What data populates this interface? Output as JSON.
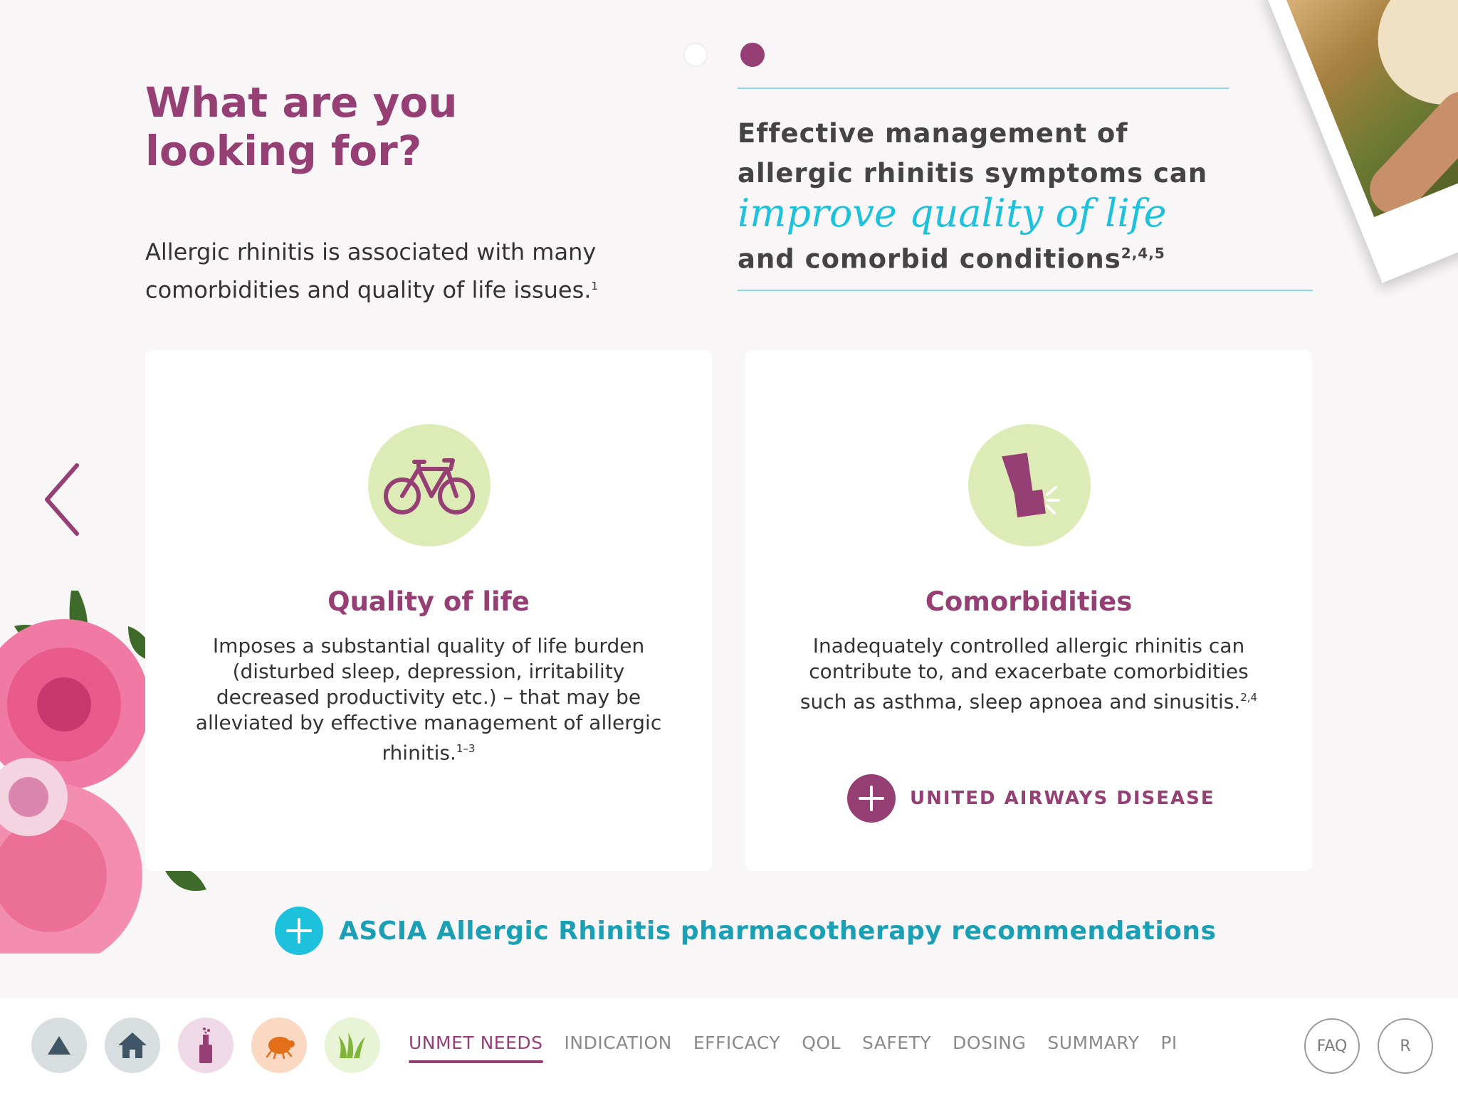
{
  "pagination": {
    "total": 2,
    "active_index": 1
  },
  "headline": "What are you looking for?",
  "intro": {
    "text": "Allergic rhinitis is associated with many comorbidities and quality of life issues.",
    "ref": "1"
  },
  "statement": {
    "line1": "Effective management of",
    "line2": "allergic rhinitis symptoms can",
    "highlight": "improve quality of life",
    "line3": "and comorbid conditions",
    "ref": "2,4,5"
  },
  "photo": {
    "description_icon": "dog-photo-icon"
  },
  "cards": [
    {
      "title": "Quality of life",
      "body": "Imposes a substantial quality of life burden (disturbed sleep, depression, irritability decreased productivity etc.) – that may be alleviated by effective management of allergic rhinitis.",
      "ref": "1–3",
      "icon": "bicycle-icon"
    },
    {
      "title": "Comorbidities",
      "body": "Inadequately controlled allergic rhinitis can contribute to, and exacerbate comorbidities such as asthma, sleep apnoea and sinusitis.",
      "ref": "2,4",
      "icon": "inhaler-icon",
      "link_label": "UNITED AIRWAYS DISEASE"
    }
  ],
  "ascia_link": "ASCIA Allergic Rhinitis pharmacotherapy recommendations",
  "bottom_nav": {
    "icons": [
      "top-triangle-icon",
      "home-icon",
      "spray-bottle-icon",
      "dust-mite-icon",
      "grass-icon"
    ],
    "links": [
      "UNMET NEEDS",
      "INDICATION",
      "EFFICACY",
      "QOL",
      "SAFETY",
      "DOSING",
      "SUMMARY",
      "PI"
    ],
    "active_link": "UNMET NEEDS",
    "faq_label": "FAQ",
    "r_label": "R"
  },
  "colors": {
    "brand_purple": "#953f74",
    "accent_cyan": "#1ec1dc",
    "icon_bg_green": "#ddecb7",
    "nav_inactive": "#8a8a8a"
  }
}
